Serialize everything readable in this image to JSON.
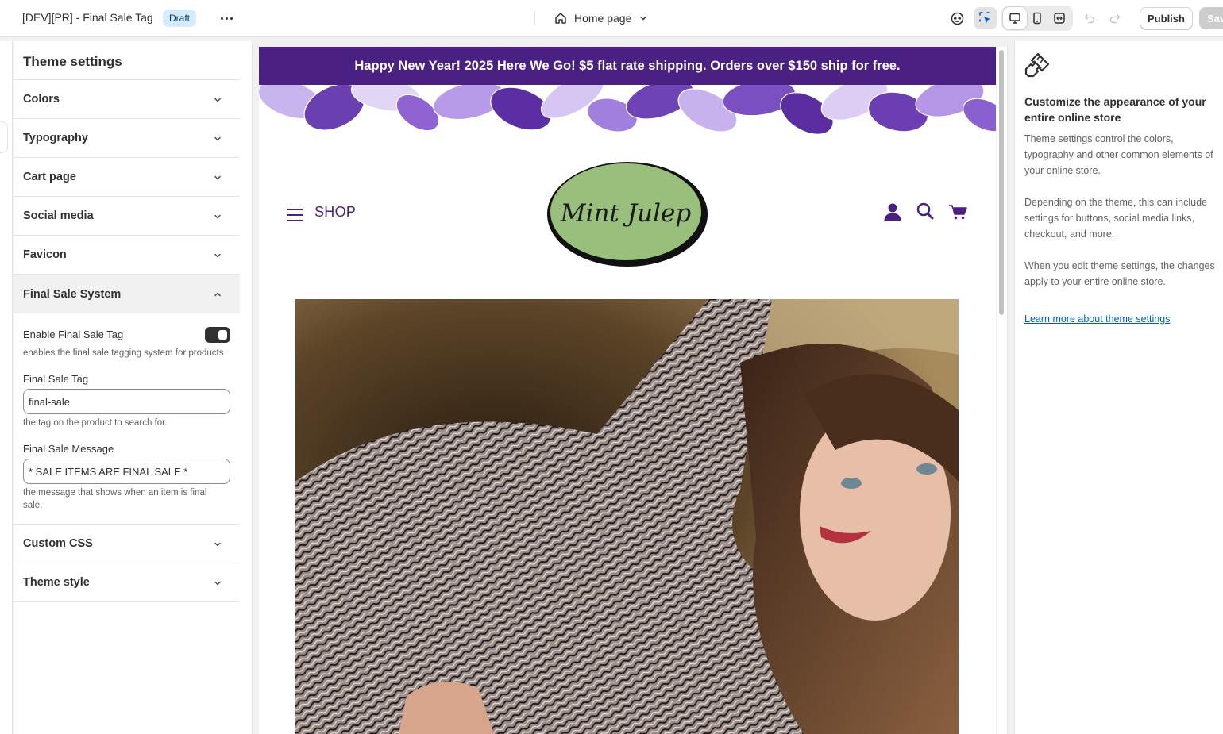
{
  "topbar": {
    "title": "[DEV][PR] - Final Sale Tag",
    "status_badge": "Draft",
    "page_selector": "Home page",
    "publish_label": "Publish",
    "save_label": "Save"
  },
  "sidebar": {
    "title": "Theme settings",
    "sections": [
      {
        "label": "Colors"
      },
      {
        "label": "Typography"
      },
      {
        "label": "Cart page"
      },
      {
        "label": "Social media"
      },
      {
        "label": "Favicon"
      },
      {
        "label": "Final Sale System",
        "expanded": true
      },
      {
        "label": "Custom CSS"
      },
      {
        "label": "Theme style"
      }
    ],
    "final_sale": {
      "enable_label": "Enable Final Sale Tag",
      "enable_value": true,
      "enable_help": "enables the final sale tagging system for products",
      "tag_label": "Final Sale Tag",
      "tag_value": "final-sale",
      "tag_help": "the tag on the product to search for.",
      "message_label": "Final Sale Message",
      "message_value": "* SALE ITEMS ARE FINAL SALE *",
      "message_help": "the message that shows when an item is final sale."
    }
  },
  "preview": {
    "announcement": "Happy New Year! 2025 Here We Go! $5 flat rate shipping. Orders over $150 ship for free.",
    "shop_link": "SHOP",
    "logo_text": "Mint Julep",
    "brand_color": "#4a2182",
    "logo_fill": "#98bf7c"
  },
  "right_panel": {
    "heading": "Customize the appearance of your entire online store",
    "paragraphs": [
      "Theme settings control the colors, typography and other common elements of your online store.",
      "Depending on the theme, this can include settings for buttons, social media links, checkout, and more.",
      "When you edit theme settings, the changes apply to your entire online store."
    ],
    "link": "Learn more about theme settings"
  }
}
